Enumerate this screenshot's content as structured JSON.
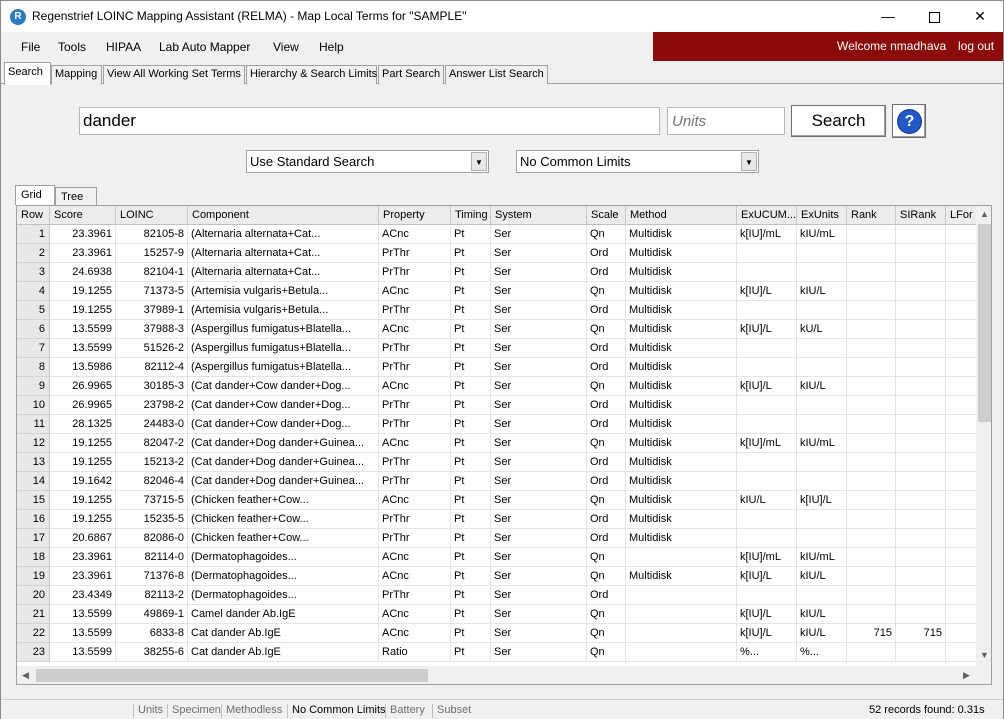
{
  "window": {
    "title": "Regenstrief LOINC Mapping Assistant (RELMA) - Map Local Terms  for \"SAMPLE\"",
    "minimize": "—",
    "close": "✕"
  },
  "menu": [
    "File",
    "Tools",
    "HIPAA",
    "Lab Auto Mapper",
    "View",
    "Help"
  ],
  "user": {
    "welcome": "Welcome nmadhava",
    "logout": "log out"
  },
  "main_tabs": [
    "Search",
    "Mapping",
    "View All Working Set Terms",
    "Hierarchy & Search Limits",
    "Part Search",
    "Answer List Search"
  ],
  "search": {
    "query": "dander",
    "units_placeholder": "Units",
    "button": "Search",
    "help": "?",
    "search_mode": "Use Standard Search",
    "limits": "No Common Limits"
  },
  "sub_tabs": [
    "Grid",
    "Tree"
  ],
  "grid": {
    "columns": [
      "Row",
      "Score",
      "LOINC",
      "Component",
      "Property",
      "Timing",
      "System",
      "Scale",
      "Method",
      "ExUCUM...",
      "ExUnits",
      "Rank",
      "SIRank",
      "LFor"
    ],
    "rows": [
      [
        "1",
        "23.3961",
        "82105-8",
        "(Alternaria alternata+Cat...",
        "ACnc",
        "Pt",
        "Ser",
        "Qn",
        "Multidisk",
        "k[IU]/mL",
        "kIU/mL",
        "",
        ""
      ],
      [
        "2",
        "23.3961",
        "15257-9",
        "(Alternaria alternata+Cat...",
        "PrThr",
        "Pt",
        "Ser",
        "Ord",
        "Multidisk",
        "",
        "",
        "",
        ""
      ],
      [
        "3",
        "24.6938",
        "82104-1",
        "(Alternaria alternata+Cat...",
        "PrThr",
        "Pt",
        "Ser",
        "Ord",
        "Multidisk",
        "",
        "",
        "",
        ""
      ],
      [
        "4",
        "19.1255",
        "71373-5",
        "(Artemisia vulgaris+Betula...",
        "ACnc",
        "Pt",
        "Ser",
        "Qn",
        "Multidisk",
        "k[IU]/L",
        "kIU/L",
        "",
        ""
      ],
      [
        "5",
        "19.1255",
        "37989-1",
        "(Artemisia vulgaris+Betula...",
        "PrThr",
        "Pt",
        "Ser",
        "Ord",
        "Multidisk",
        "",
        "",
        "",
        ""
      ],
      [
        "6",
        "13.5599",
        "37988-3",
        "(Aspergillus fumigatus+Blatella...",
        "ACnc",
        "Pt",
        "Ser",
        "Qn",
        "Multidisk",
        "k[IU]/L",
        "kU/L",
        "",
        ""
      ],
      [
        "7",
        "13.5599",
        "51526-2",
        "(Aspergillus fumigatus+Blatella...",
        "PrThr",
        "Pt",
        "Ser",
        "Ord",
        "Multidisk",
        "",
        "",
        "",
        ""
      ],
      [
        "8",
        "13.5986",
        "82112-4",
        "(Aspergillus fumigatus+Blatella...",
        "PrThr",
        "Pt",
        "Ser",
        "Ord",
        "Multidisk",
        "",
        "",
        "",
        ""
      ],
      [
        "9",
        "26.9965",
        "30185-3",
        "(Cat dander+Cow dander+Dog...",
        "ACnc",
        "Pt",
        "Ser",
        "Qn",
        "Multidisk",
        "k[IU]/L",
        "kIU/L",
        "",
        ""
      ],
      [
        "10",
        "26.9965",
        "23798-2",
        "(Cat dander+Cow dander+Dog...",
        "PrThr",
        "Pt",
        "Ser",
        "Ord",
        "Multidisk",
        "",
        "",
        "",
        ""
      ],
      [
        "11",
        "28.1325",
        "24483-0",
        "(Cat dander+Cow dander+Dog...",
        "PrThr",
        "Pt",
        "Ser",
        "Ord",
        "Multidisk",
        "",
        "",
        "",
        ""
      ],
      [
        "12",
        "19.1255",
        "82047-2",
        "(Cat dander+Dog dander+Guinea...",
        "ACnc",
        "Pt",
        "Ser",
        "Qn",
        "Multidisk",
        "k[IU]/mL",
        "kIU/mL",
        "",
        ""
      ],
      [
        "13",
        "19.1255",
        "15213-2",
        "(Cat dander+Dog dander+Guinea...",
        "PrThr",
        "Pt",
        "Ser",
        "Ord",
        "Multidisk",
        "",
        "",
        "",
        ""
      ],
      [
        "14",
        "19.1642",
        "82046-4",
        "(Cat dander+Dog dander+Guinea...",
        "PrThr",
        "Pt",
        "Ser",
        "Ord",
        "Multidisk",
        "",
        "",
        "",
        ""
      ],
      [
        "15",
        "19.1255",
        "73715-5",
        "(Chicken feather+Cow...",
        "ACnc",
        "Pt",
        "Ser",
        "Qn",
        "Multidisk",
        "kIU/L",
        "k[IU]/L",
        "",
        ""
      ],
      [
        "16",
        "19.1255",
        "15235-5",
        "(Chicken feather+Cow...",
        "PrThr",
        "Pt",
        "Ser",
        "Ord",
        "Multidisk",
        "",
        "",
        "",
        ""
      ],
      [
        "17",
        "20.6867",
        "82086-0",
        "(Chicken feather+Cow...",
        "PrThr",
        "Pt",
        "Ser",
        "Ord",
        "Multidisk",
        "",
        "",
        "",
        ""
      ],
      [
        "18",
        "23.3961",
        "82114-0",
        "(Dermatophagoides...",
        "ACnc",
        "Pt",
        "Ser",
        "Qn",
        "",
        "k[IU]/mL",
        "kIU/mL",
        "",
        ""
      ],
      [
        "19",
        "23.3961",
        "71376-8",
        "(Dermatophagoides...",
        "ACnc",
        "Pt",
        "Ser",
        "Qn",
        "Multidisk",
        "k[IU]/L",
        "kIU/L",
        "",
        ""
      ],
      [
        "20",
        "23.4349",
        "82113-2",
        "(Dermatophagoides...",
        "PrThr",
        "Pt",
        "Ser",
        "Ord",
        "",
        "",
        "",
        "",
        ""
      ],
      [
        "21",
        "13.5599",
        "49869-1",
        "Camel dander Ab.IgE",
        "ACnc",
        "Pt",
        "Ser",
        "Qn",
        "",
        "k[IU]/L",
        "kIU/L",
        "",
        ""
      ],
      [
        "22",
        "13.5599",
        "6833-8",
        "Cat dander Ab.IgE",
        "ACnc",
        "Pt",
        "Ser",
        "Qn",
        "",
        "k[IU]/L",
        "kIU/L",
        "715",
        "715"
      ],
      [
        "23",
        "13.5599",
        "38255-6",
        "Cat dander Ab.IgE",
        "Ratio",
        "Pt",
        "Ser",
        "Qn",
        "",
        "%...",
        "%...",
        "",
        ""
      ]
    ]
  },
  "status": {
    "items": [
      "Units",
      "Specimen",
      "Methodless",
      "No Common Limits",
      "Battery",
      "Subset"
    ],
    "active": "No Common Limits",
    "records": "52 records found: 0.31s"
  }
}
